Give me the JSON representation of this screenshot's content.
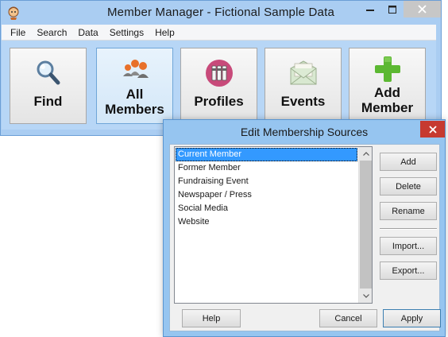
{
  "window": {
    "title": "Member Manager - Fictional Sample Data"
  },
  "menu": {
    "items": [
      "File",
      "Search",
      "Data",
      "Settings",
      "Help"
    ]
  },
  "toolbar": {
    "buttons": [
      {
        "line1": "Find",
        "line2": "",
        "icon": "magnifier-icon",
        "active": false
      },
      {
        "line1": "All",
        "line2": "Members",
        "icon": "people-icon",
        "active": true
      },
      {
        "line1": "Profiles",
        "line2": "",
        "icon": "binders-icon",
        "active": false
      },
      {
        "line1": "Events",
        "line2": "",
        "icon": "envelope-icon",
        "active": false
      },
      {
        "line1": "Add",
        "line2": "Member",
        "icon": "plus-icon",
        "active": false
      }
    ]
  },
  "dialog": {
    "title": "Edit Membership Sources",
    "list": {
      "items": [
        "Current Member",
        "Former Member",
        "Fundraising Event",
        "Newspaper / Press",
        "Social Media",
        "Website"
      ],
      "selected_index": 0
    },
    "buttons": {
      "add": "Add",
      "delete": "Delete",
      "rename": "Rename",
      "import": "Import...",
      "export": "Export...",
      "help": "Help",
      "cancel": "Cancel",
      "apply": "Apply"
    }
  },
  "colors": {
    "window_frame": "#aacdf2",
    "dialog_frame": "#96c5f0",
    "selection": "#3399ff",
    "close_red": "#c63a30",
    "add_green": "#5cb832"
  }
}
